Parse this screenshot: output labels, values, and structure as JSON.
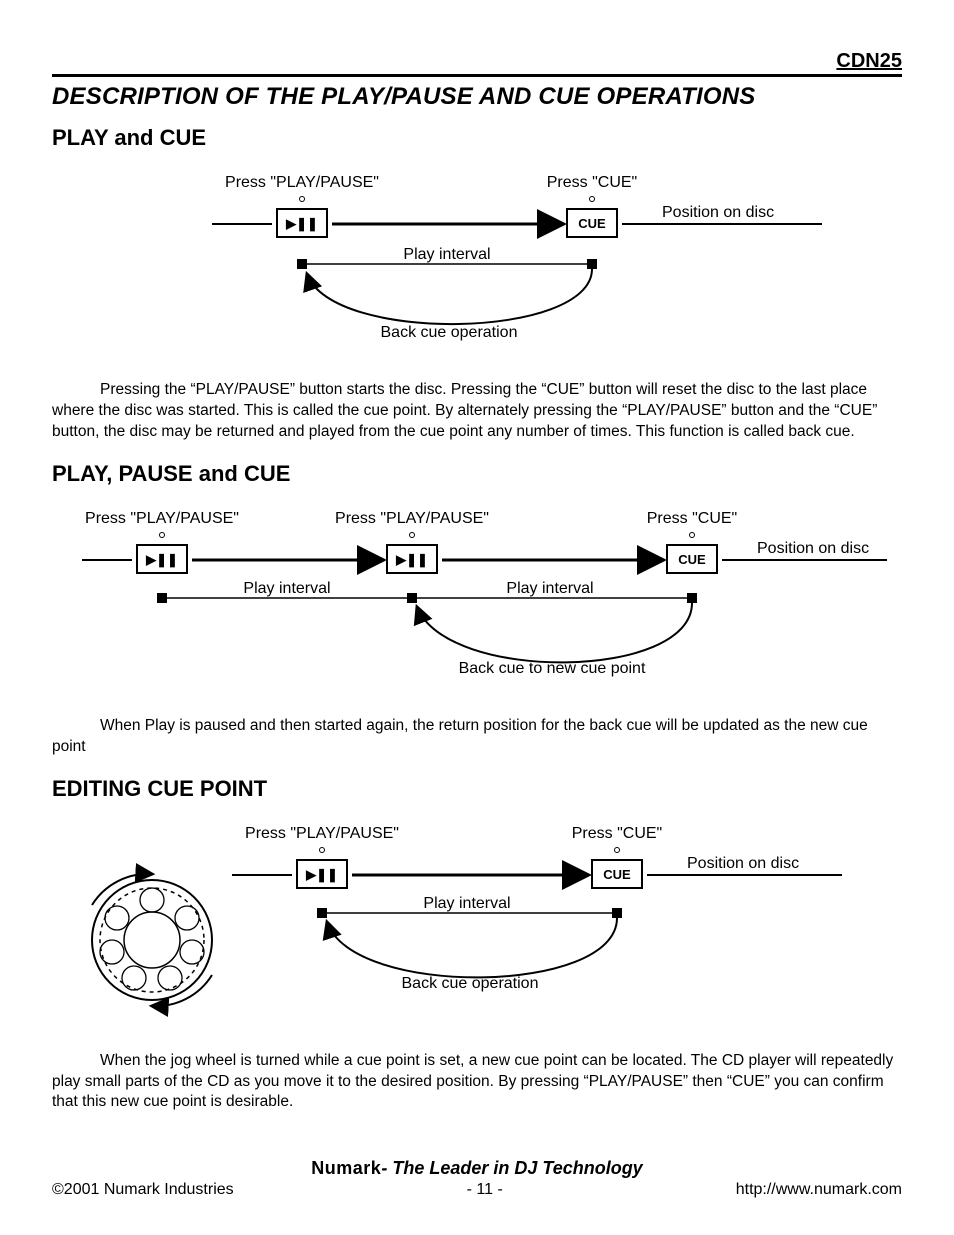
{
  "header": {
    "model": "CDN25",
    "title": "DESCRIPTION OF THE PLAY/PAUSE AND CUE OPERATIONS"
  },
  "s1": {
    "heading": "PLAY and CUE",
    "d": {
      "press_pp": "Press \"PLAY/PAUSE\"",
      "press_cue": "Press \"CUE\"",
      "pos": "Position on disc",
      "interval": "Play interval",
      "back": "Back cue operation",
      "btn_pp": "▶❚❚",
      "btn_cue": "CUE"
    },
    "para": "Pressing the “PLAY/PAUSE” button starts the disc. Pressing the “CUE” button will reset the disc to the last place where the disc was started.   This is called the cue point.  By alternately pressing the “PLAY/PAUSE” button and the “CUE” button, the disc may be returned and played from the cue point any number of times.  This function is called back cue."
  },
  "s2": {
    "heading": "PLAY, PAUSE and CUE",
    "d": {
      "press_pp": "Press \"PLAY/PAUSE\"",
      "press_cue": "Press \"CUE\"",
      "pos": "Position on disc",
      "interval": "Play interval",
      "back": "Back cue to new cue point",
      "btn_pp": "▶❚❚",
      "btn_cue": "CUE"
    },
    "para": "When Play is paused and then started again, the return position for the back cue will be updated as the new cue point"
  },
  "s3": {
    "heading": "EDITING CUE POINT",
    "d": {
      "press_pp": "Press \"PLAY/PAUSE\"",
      "press_cue": "Press \"CUE\"",
      "pos": "Position on disc",
      "interval": "Play interval",
      "back": "Back cue operation",
      "btn_pp": "▶❚❚",
      "btn_cue": "CUE"
    },
    "para": "When the jog wheel is turned while a cue point is set, a new cue point can be located.   The CD player will repeatedly play small parts of the CD as you move it to the desired position.  By pressing “PLAY/PAUSE” then “CUE” you can confirm that this new cue point is desirable."
  },
  "footer": {
    "brand": "Numark",
    "tagline": "- The Leader in DJ Technology",
    "copyright": "©2001 Numark Industries",
    "page": "- 11 -",
    "url": "http://www.numark.com"
  }
}
